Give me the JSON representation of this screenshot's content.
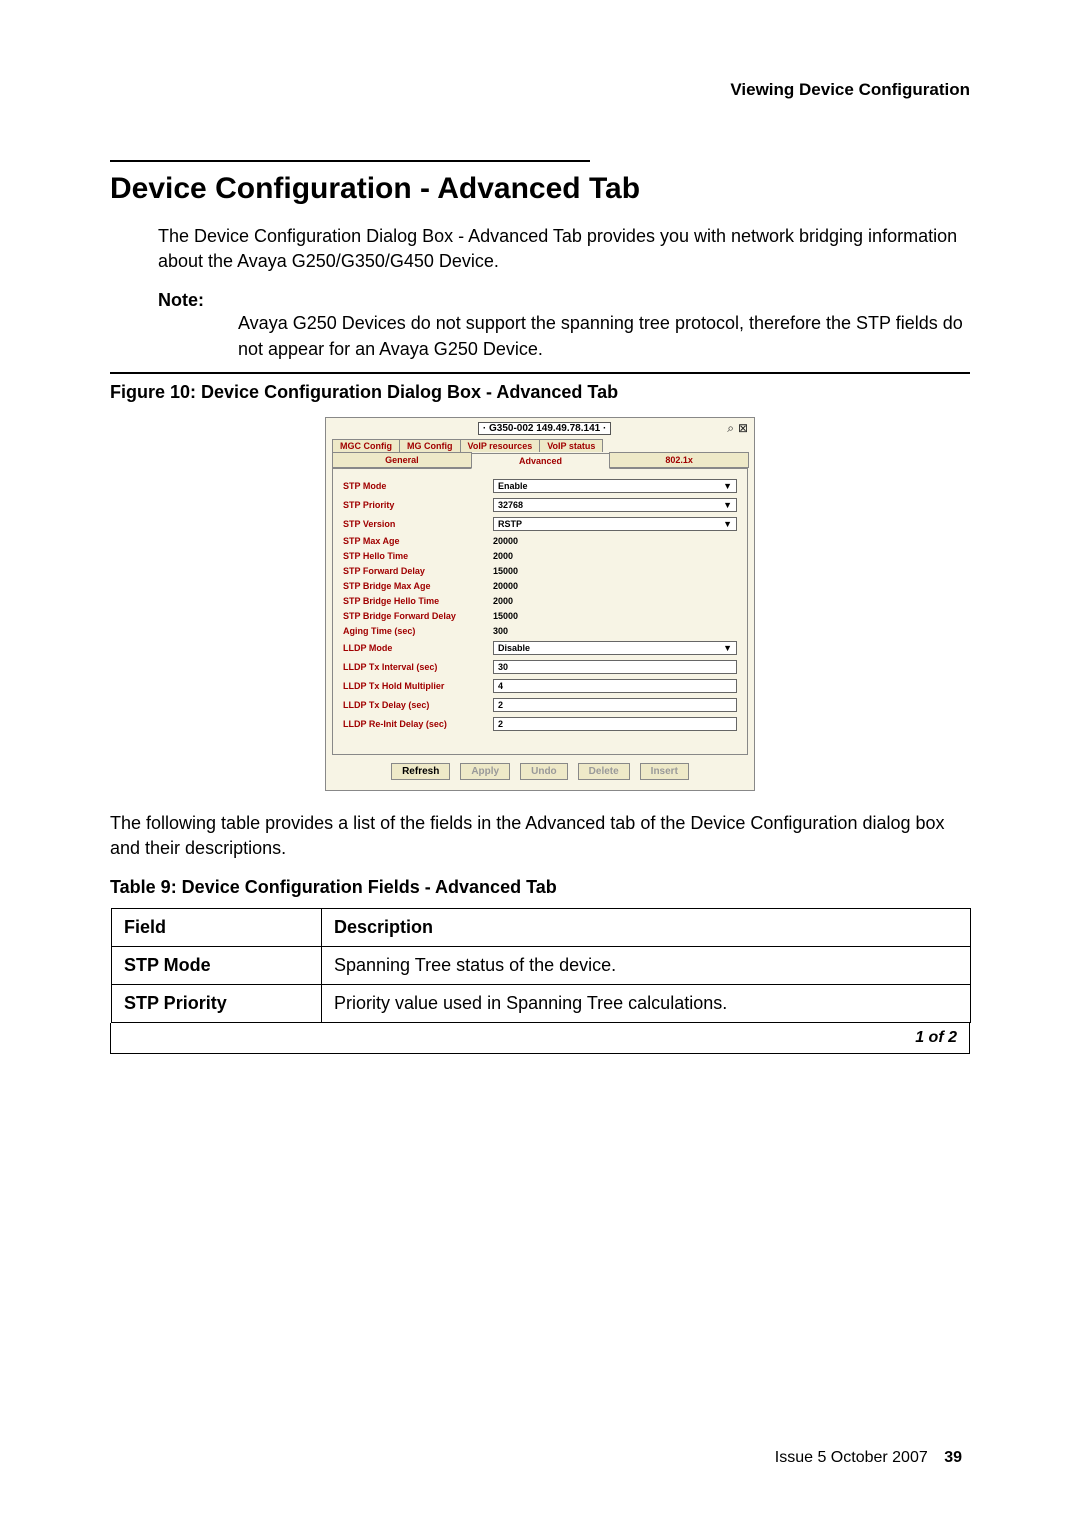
{
  "header": {
    "section_title": "Viewing Device Configuration"
  },
  "title": "Device Configuration - Advanced Tab",
  "intro": "The Device Configuration Dialog Box - Advanced Tab provides you with network bridging information about the Avaya G250/G350/G450 Device.",
  "note": {
    "label": "Note:",
    "text": "Avaya G250 Devices do not support the spanning tree protocol, therefore the STP fields do not appear for an Avaya G250 Device."
  },
  "figure_caption": "Figure 10: Device Configuration Dialog Box - Advanced Tab",
  "dialog": {
    "title": "· G350-002 149.49.78.141 ·",
    "tabs_row1": [
      "MGC Config",
      "MG Config",
      "VoIP resources",
      "VoIP status"
    ],
    "tabs_row2": [
      "General",
      "Advanced",
      "802.1x"
    ],
    "active_tab": "Advanced",
    "fields": {
      "stp_mode": {
        "label": "STP Mode",
        "type": "select",
        "value": "Enable"
      },
      "stp_priority": {
        "label": "STP Priority",
        "type": "select",
        "value": "32768"
      },
      "stp_version": {
        "label": "STP Version",
        "type": "select",
        "value": "RSTP"
      },
      "stp_max_age": {
        "label": "STP Max Age",
        "type": "text",
        "value": "20000"
      },
      "stp_hello": {
        "label": "STP Hello Time",
        "type": "text",
        "value": "2000"
      },
      "stp_fwd": {
        "label": "STP Forward Delay",
        "type": "text",
        "value": "15000"
      },
      "stp_b_max": {
        "label": "STP Bridge Max Age",
        "type": "text",
        "value": "20000"
      },
      "stp_b_hello": {
        "label": "STP Bridge Hello Time",
        "type": "text",
        "value": "2000"
      },
      "stp_b_fwd": {
        "label": "STP Bridge Forward Delay",
        "type": "text",
        "value": "15000"
      },
      "aging": {
        "label": "Aging Time (sec)",
        "type": "text",
        "value": "300"
      },
      "lldp_mode": {
        "label": "LLDP Mode",
        "type": "select",
        "value": "Disable"
      },
      "lldp_tx_int": {
        "label": "LLDP Tx Interval (sec)",
        "type": "input",
        "value": "30"
      },
      "lldp_tx_hold": {
        "label": "LLDP Tx Hold Multiplier",
        "type": "input",
        "value": "4"
      },
      "lldp_tx_delay": {
        "label": "LLDP Tx Delay (sec)",
        "type": "input",
        "value": "2"
      },
      "lldp_reinit": {
        "label": "LLDP Re-Init Delay (sec)",
        "type": "input",
        "value": "2"
      }
    },
    "buttons": {
      "refresh": "Refresh",
      "apply": "Apply",
      "undo": "Undo",
      "delete": "Delete",
      "insert": "Insert"
    }
  },
  "post_text": "The following table provides a list of the fields in the Advanced tab of the Device Configuration dialog box and their descriptions.",
  "table_caption": "Table 9: Device Configuration Fields - Advanced Tab",
  "table": {
    "headers": {
      "field": "Field",
      "desc": "Description"
    },
    "rows": [
      {
        "field": "STP Mode",
        "desc": "Spanning Tree status of the device."
      },
      {
        "field": "STP Priority",
        "desc": "Priority value used in Spanning Tree calculations."
      }
    ],
    "page_of": "1 of 2"
  },
  "footer": {
    "issue": "Issue 5   October 2007",
    "page": "39"
  }
}
